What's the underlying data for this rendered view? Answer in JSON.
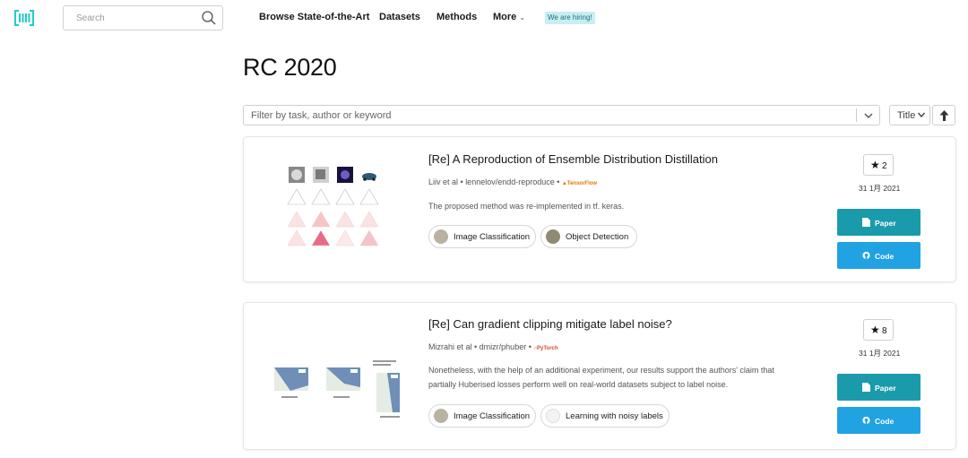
{
  "nav": {
    "search_placeholder": "Search",
    "links": [
      "Browse State-of-the-Art",
      "Datasets",
      "Methods",
      "More"
    ],
    "hiring_badge": "We are hiring!"
  },
  "page": {
    "title": "RC 2020",
    "filter_placeholder": "Filter by task, author or keyword",
    "sort_value": "Title"
  },
  "papers": [
    {
      "title": "[Re] A Reproduction of Ensemble Distribution Distillation",
      "authors": "Liiv et al",
      "repo": "lennelov/endd-reproduce",
      "framework": "TensorFlow",
      "abstract": "The proposed method was re-implemented in tf. keras.",
      "tags": [
        "Image Classification",
        "Object Detection"
      ],
      "stars": "2",
      "date": "31 1月 2021",
      "paper_label": "Paper",
      "code_label": "Code"
    },
    {
      "title": "[Re] Can gradient clipping mitigate label noise?",
      "authors": "Mizrahi et al",
      "repo": "dmizr/phuber",
      "framework": "PyTorch",
      "abstract": "Nonetheless, with the help of an additional experiment, our results support the authors' claim that partially Huberised losses perform well on real-world datasets subject to label noise.",
      "tags": [
        "Image Classification",
        "Learning with noisy labels"
      ],
      "stars": "8",
      "date": "31 1月 2021",
      "paper_label": "Paper",
      "code_label": "Code"
    }
  ],
  "colors": {
    "brand": "#21cbce",
    "paper_button": "#1a9bac",
    "code_button": "#21a2e2",
    "hiring_bg": "#c9eef2"
  },
  "icons": [
    "logo-icon",
    "search-icon",
    "chevron-down-icon",
    "sort-arrow-up-icon",
    "star-icon",
    "file-icon",
    "github-icon"
  ]
}
